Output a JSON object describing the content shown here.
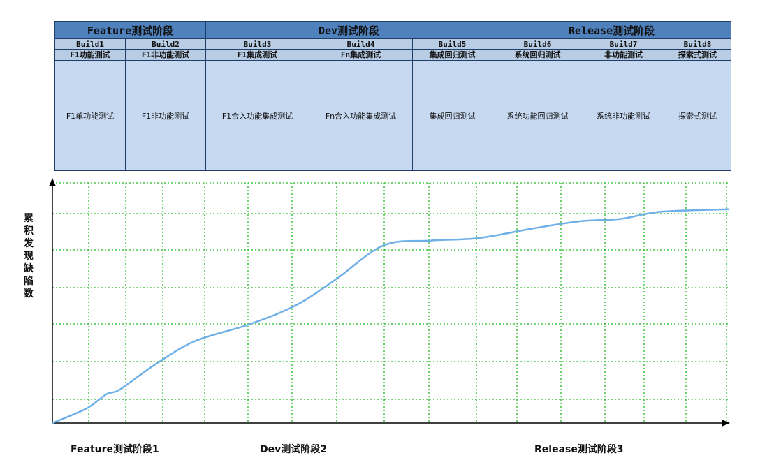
{
  "phases": [
    {
      "label": "Feature测试阶段",
      "span": 2
    },
    {
      "label": "Dev测试阶段",
      "span": 3
    },
    {
      "label": "Release测试阶段",
      "span": 3
    }
  ],
  "builds": [
    "Build1",
    "Build2",
    "Build3",
    "Build4",
    "Build5",
    "Build6",
    "Build7",
    "Build8"
  ],
  "test_types": [
    "F1功能测试",
    "F1非功能测试",
    "F1集成测试",
    "Fn集成测试",
    "集成回归测试",
    "系统回归测试",
    "非功能测试",
    "探索式测试"
  ],
  "test_descriptions": [
    "F1单功能测试",
    "F1非功能测试",
    "F1合入功能集成测试",
    "Fn合入功能集成测试",
    "集成回归测试",
    "系统功能回归测试",
    "系统非功能测试",
    "探索式测试"
  ],
  "chart_data": {
    "type": "line",
    "ylabel": "累积发现缺陷数",
    "x_categories": [
      "Feature测试阶段1",
      "Dev测试阶段2",
      "Release测试阶段3"
    ],
    "grid": true,
    "series": [
      {
        "color": "#6fb0e8",
        "points": [
          [
            0,
            0
          ],
          [
            0.05,
            0.06
          ],
          [
            0.08,
            0.12
          ],
          [
            0.1,
            0.14
          ],
          [
            0.15,
            0.24
          ],
          [
            0.21,
            0.34
          ],
          [
            0.29,
            0.41
          ],
          [
            0.36,
            0.49
          ],
          [
            0.42,
            0.6
          ],
          [
            0.49,
            0.74
          ],
          [
            0.56,
            0.76
          ],
          [
            0.63,
            0.77
          ],
          [
            0.71,
            0.81
          ],
          [
            0.78,
            0.84
          ],
          [
            0.84,
            0.85
          ],
          [
            0.9,
            0.88
          ],
          [
            1.0,
            0.89
          ]
        ]
      }
    ],
    "colors": {
      "grid": "#22bb22",
      "axis": "#000000"
    }
  }
}
